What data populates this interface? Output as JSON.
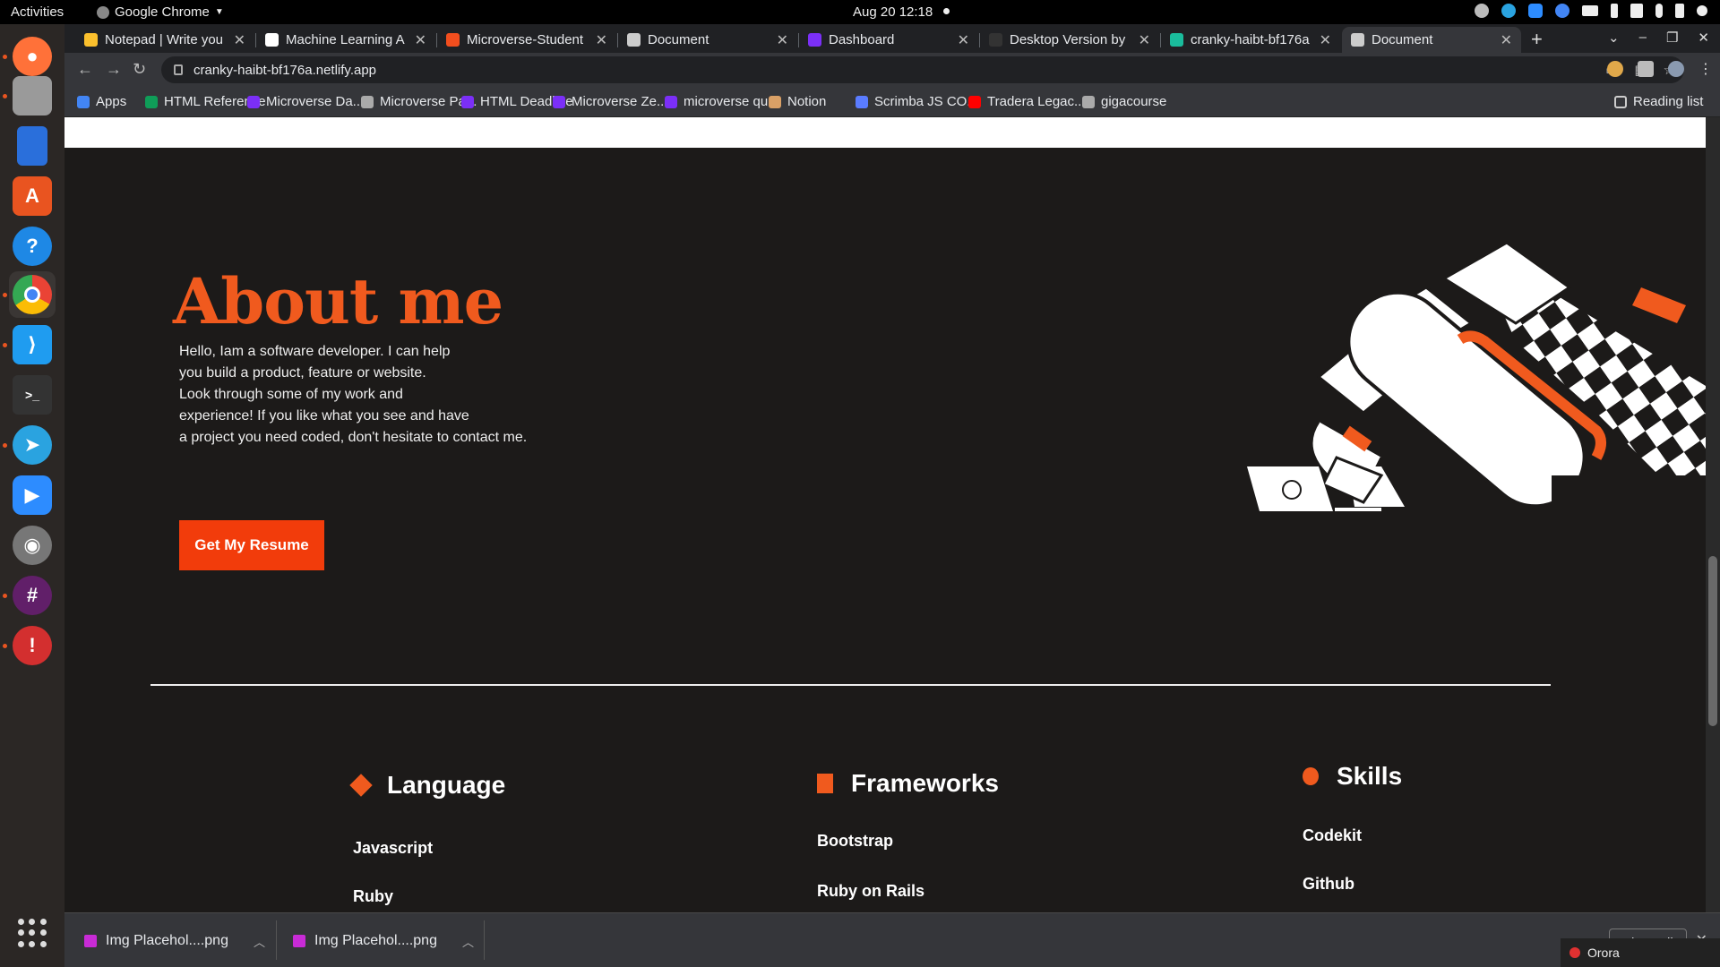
{
  "system": {
    "activities": "Activities",
    "app_name": "Google Chrome",
    "clock": "Aug 20  12:18"
  },
  "dock": {
    "items": [
      {
        "name": "firefox",
        "color": "#ff7139"
      },
      {
        "name": "files",
        "color": "#9a9a9a"
      },
      {
        "name": "libreoffice-writer",
        "color": "#2a6fdb"
      },
      {
        "name": "software-center",
        "color": "#e95420"
      },
      {
        "name": "help",
        "color": "#1e88e5"
      },
      {
        "name": "chrome",
        "color": "#4285f4"
      },
      {
        "name": "vscode",
        "color": "#1f9cf0"
      },
      {
        "name": "terminal",
        "color": "#333333"
      },
      {
        "name": "telegram",
        "color": "#2aa3e0"
      },
      {
        "name": "zoom",
        "color": "#2d8cff"
      },
      {
        "name": "usb-creator",
        "color": "#777777"
      },
      {
        "name": "slack",
        "color": "#611f69"
      },
      {
        "name": "warning-app",
        "color": "#d32f2f"
      }
    ]
  },
  "browser": {
    "tabs": [
      {
        "title": "Notepad | Write you",
        "color": "#fbc02d"
      },
      {
        "title": "Machine Learning A",
        "color": "#ffffff"
      },
      {
        "title": "Microverse-Student",
        "color": "#f24e1e"
      },
      {
        "title": "Document",
        "color": "#cccccc"
      },
      {
        "title": "Dashboard",
        "color": "#7b2ff7"
      },
      {
        "title": "Desktop Version by",
        "color": "#333333"
      },
      {
        "title": "cranky-haibt-bf176a",
        "color": "#1abc9c"
      },
      {
        "title": "Document",
        "color": "#cccccc",
        "active": true
      }
    ],
    "url": "cranky-haibt-bf176a.netlify.app",
    "bookmarks": [
      {
        "label": "Apps",
        "color": "#4285f4"
      },
      {
        "label": "HTML Reference",
        "color": "#0f9d58"
      },
      {
        "label": "Microverse Da...",
        "color": "#7b2ff7"
      },
      {
        "label": "Microverse Pa...",
        "color": "#aaaaaa"
      },
      {
        "label": "HTML Deadline",
        "color": "#7b2ff7"
      },
      {
        "label": "Microverse Ze...",
        "color": "#7b2ff7"
      },
      {
        "label": "microverse qu...",
        "color": "#7b2ff7"
      },
      {
        "label": "Notion",
        "color": "#d9a066"
      },
      {
        "label": "Scrimba JS CO...",
        "color": "#5a7cff"
      },
      {
        "label": "Tradera Legac...",
        "color": "#ff0000"
      },
      {
        "label": "gigacourse",
        "color": "#aaaaaa"
      }
    ],
    "reading_list": "Reading list"
  },
  "page": {
    "title": "About me",
    "intro_lines": [
      "Hello, Iam a software developer. I can help",
      "you build a product, feature or website.",
      "Look through some of my work and",
      "experience! If you like what you see and have",
      "a project you need coded, don't hesitate to contact me."
    ],
    "resume_button": "Get My Resume",
    "accent_color": "#f05a1e",
    "columns": [
      {
        "title": "Language",
        "marker": "diamond",
        "items": [
          "Javascript",
          "Ruby"
        ]
      },
      {
        "title": "Frameworks",
        "marker": "square",
        "items": [
          "Bootstrap",
          "Ruby on Rails"
        ]
      },
      {
        "title": "Skills",
        "marker": "circle",
        "items": [
          "Codekit",
          "Github"
        ]
      }
    ]
  },
  "downloads": {
    "items": [
      "Img Placehol....png",
      "Img Placehol....png"
    ],
    "show_all": "Show all"
  },
  "notification": {
    "label": "Orora"
  }
}
